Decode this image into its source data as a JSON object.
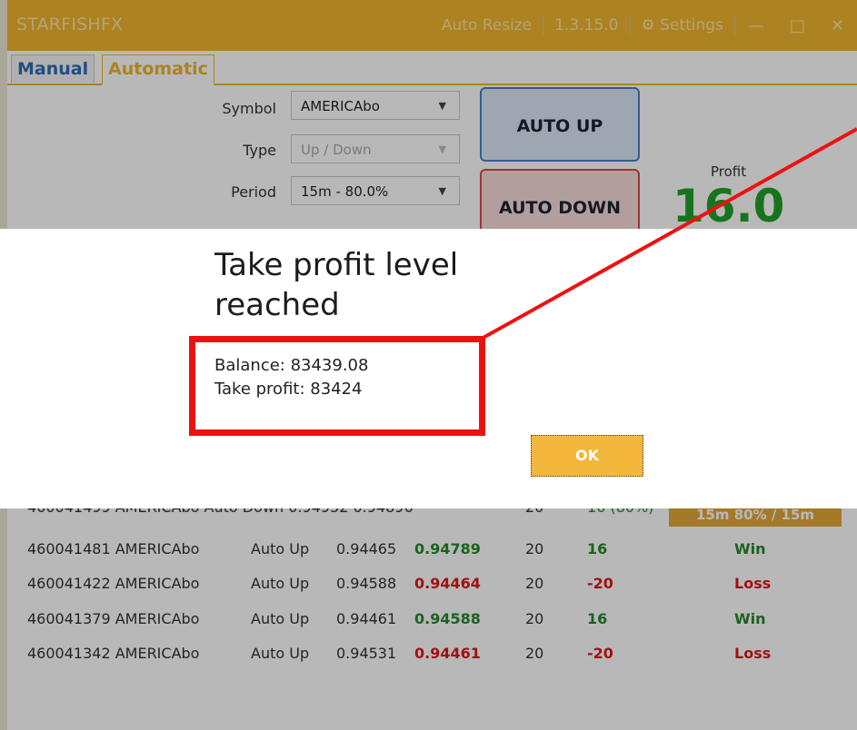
{
  "window": {
    "app_name": "STARFISHFX",
    "auto_resize": "Auto Resize",
    "version": "1.3.15.0",
    "settings": "Settings",
    "minimize": "—",
    "maximize": "□",
    "close": "✕"
  },
  "tabs": {
    "manual": "Manual",
    "automatic": "Automatic"
  },
  "form": {
    "symbol": {
      "label": "Symbol",
      "value": "AMERICAbo"
    },
    "type": {
      "label": "Type",
      "value": "Up / Down"
    },
    "period": {
      "label": "Period",
      "value": "15m - 80.0%"
    }
  },
  "buttons": {
    "auto_up": "AUTO UP",
    "auto_down": "AUTO DOWN"
  },
  "profit": {
    "label": "Profit",
    "value": "16.0"
  },
  "partial_row": {
    "text": "460041499 AMERICAbo Auto Down 0.94932 0.94896",
    "amount": "20",
    "profit": "16 (80%)",
    "badge": "15m 80% / 15m"
  },
  "trades": [
    {
      "id": "460041481 AMERICAbo",
      "type": "Auto Up",
      "open": "0.94465",
      "close": "0.94789",
      "close_color": "green",
      "amount": "20",
      "profit": "16",
      "result": "Win"
    },
    {
      "id": "460041422 AMERICAbo",
      "type": "Auto Up",
      "open": "0.94588",
      "close": "0.94464",
      "close_color": "red",
      "amount": "20",
      "profit": "-20",
      "result": "Loss"
    },
    {
      "id": "460041379 AMERICAbo",
      "type": "Auto Up",
      "open": "0.94461",
      "close": "0.94588",
      "close_color": "green",
      "amount": "20",
      "profit": "16",
      "result": "Win"
    },
    {
      "id": "460041342 AMERICAbo",
      "type": "Auto Up",
      "open": "0.94531",
      "close": "0.94461",
      "close_color": "red",
      "amount": "20",
      "profit": "-20",
      "result": "Loss"
    }
  ],
  "dialog": {
    "title": "Take profit level reached",
    "balance": "Balance: 83439.08",
    "take_profit": "Take profit: 83424",
    "ok": "OK"
  },
  "colors": {
    "accent": "#f0b52e",
    "win": "#23892a",
    "loss": "#e01818",
    "annotation": "#ee1111"
  }
}
